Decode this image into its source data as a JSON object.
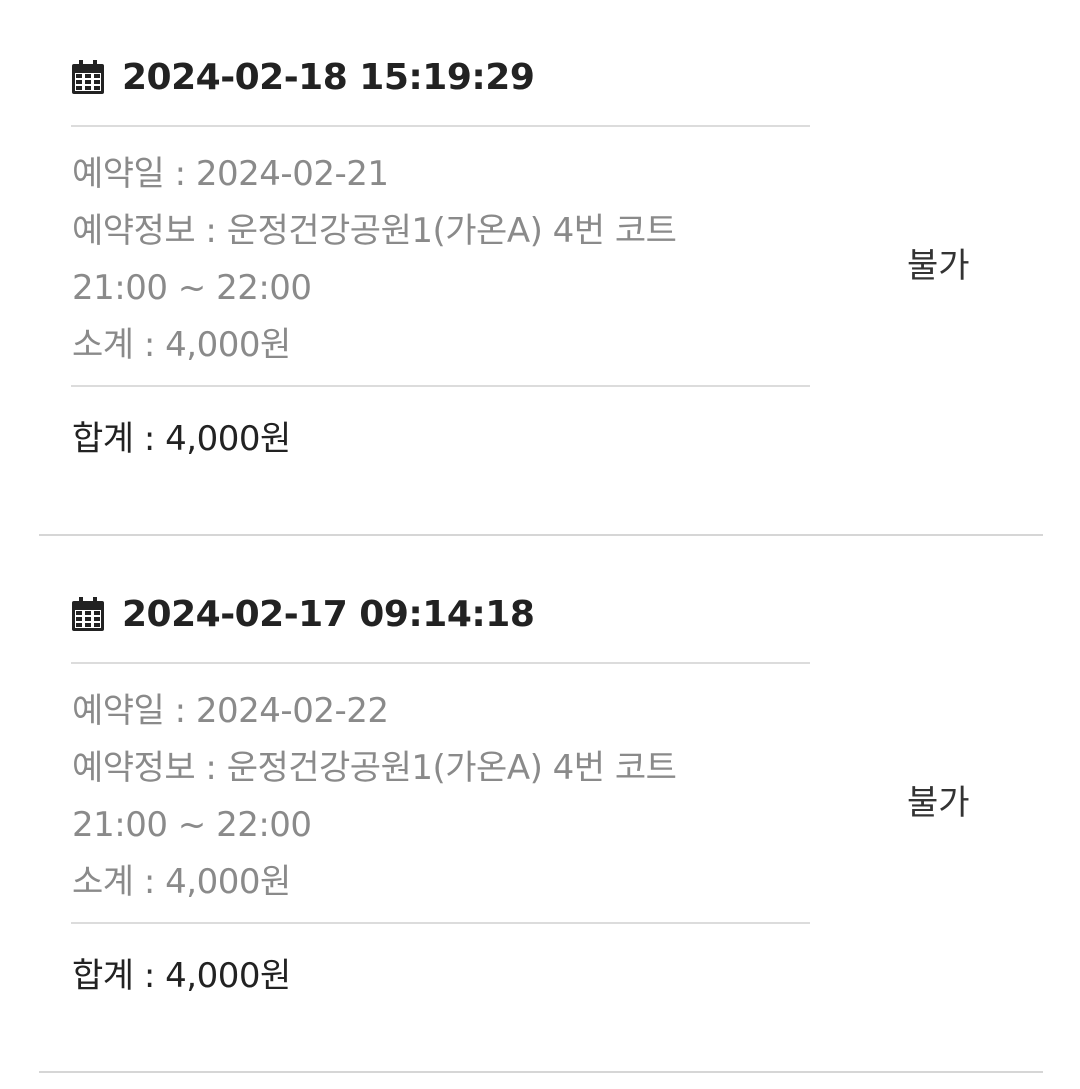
{
  "reservations": [
    {
      "datetime": "2024-02-18 15:19:29",
      "icon": "calendar-icon",
      "date_line": "예약일 : 2024-02-21",
      "info_line": "예약정보 : 운정건강공원1(가온A) 4번 코트",
      "time_line": "21:00 ~ 22:00",
      "subtotal_line": "소계 : 4,000원",
      "total_line": "합계 : 4,000원",
      "status": "불가"
    },
    {
      "datetime": "2024-02-17 09:14:18",
      "icon": "calendar-icon",
      "date_line": "예약일 : 2024-02-22",
      "info_line": "예약정보 : 운정건강공원1(가온A) 4번 코트",
      "time_line": "21:00 ~ 22:00",
      "subtotal_line": "소계 : 4,000원",
      "total_line": "합계 : 4,000원",
      "status": "불가"
    }
  ],
  "colors": {
    "primary_text": "#222222",
    "secondary_text": "#8a8a8a",
    "divider": "#dcdcdc"
  }
}
